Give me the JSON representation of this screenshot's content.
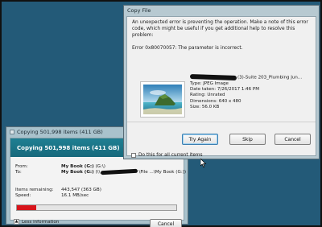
{
  "copy_dialog": {
    "title": "Copying 501,998 items (411 GB)",
    "banner": "Copying 501,998 items (411 GB)",
    "from_label": "From:",
    "from_value": "My Book (G:)",
    "from_suffix": " (G:\\)",
    "to_label": "To:",
    "to_value": "My Book (G:)",
    "to_prefix": " (\\\\",
    "to_suffix": "\\File ...\\My Book (G:))",
    "remaining_label": "Items remaining:",
    "remaining_value": "443,547 (363 GB)",
    "speed_label": "Speed:",
    "speed_value": "16.1 MB/sec",
    "progress_fraction": 0.12,
    "less_info": "Less information",
    "cancel": "Cancel",
    "progress_color": "#d8141b"
  },
  "error_dialog": {
    "title": "Copy File",
    "message": "An unexpected error is preventing the operation. Make a note of this error code, which might be useful if you get additional help to resolve this problem:",
    "error_code": "Error 0x80070057: The parameter is incorrect.",
    "file": {
      "name_suffix": "(3)-Suite 203_Plumbing Jun...",
      "type": "Type: JPEG Image",
      "date": "Date taken: 7/26/2017 1:46 PM",
      "rating": "Rating: Unrated",
      "dimensions": "Dimensions: 640 x 480",
      "size": "Size: 56.0 KB"
    },
    "try_again": "Try Again",
    "skip": "Skip",
    "cancel": "Cancel",
    "checkbox_label": "Do this for all current items"
  }
}
